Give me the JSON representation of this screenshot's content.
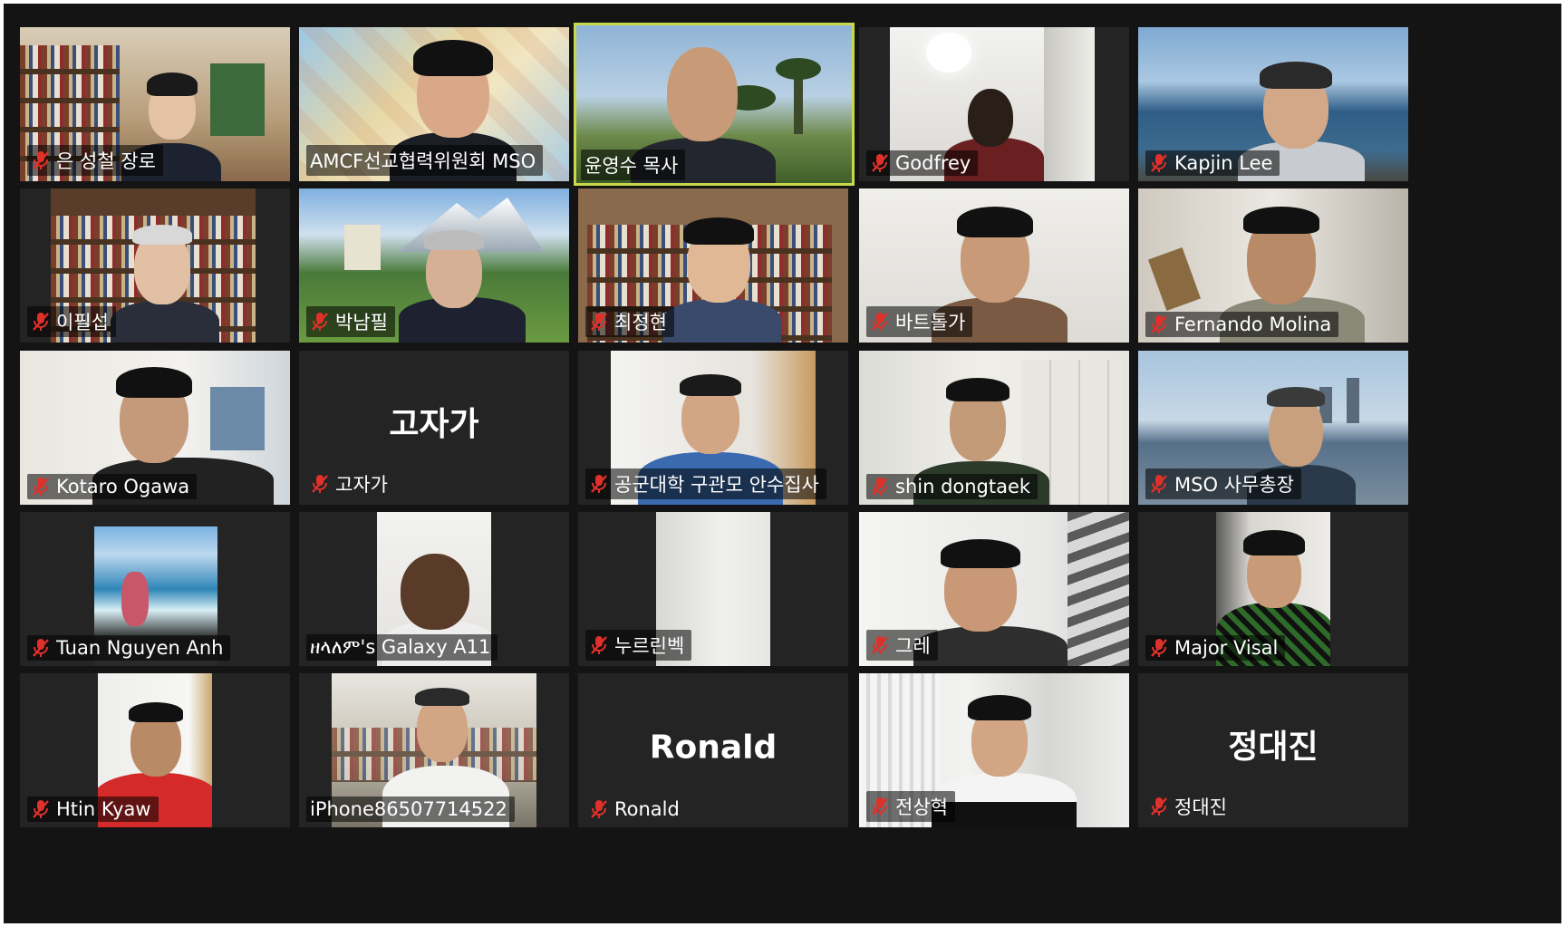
{
  "colors": {
    "background": "#141414",
    "tile": "#242424",
    "active_border": "#c7d84a",
    "muted_mic": "#e0302a",
    "label_text": "#ffffff"
  },
  "participants": [
    {
      "name": "은 성철 장로",
      "muted": true
    },
    {
      "name": "AMCF선교협력위원회 MSO",
      "muted": false
    },
    {
      "name": "윤영수 목사",
      "muted": false,
      "active_speaker": true
    },
    {
      "name": "Godfrey",
      "muted": true
    },
    {
      "name": "Kapjin Lee",
      "muted": true
    },
    {
      "name": "이필섭",
      "muted": true
    },
    {
      "name": "박남필",
      "muted": true
    },
    {
      "name": "최정현",
      "muted": true
    },
    {
      "name": "바트톨가",
      "muted": true
    },
    {
      "name": "Fernando Molina",
      "muted": true
    },
    {
      "name": "Kotaro Ogawa",
      "muted": true
    },
    {
      "name": "고자가",
      "muted": true,
      "video_off": true,
      "display_name": "고자가"
    },
    {
      "name": "공군대학 구관모 안수집사",
      "muted": true
    },
    {
      "name": "shin dongtaek",
      "muted": true
    },
    {
      "name": "MSO 사무총장",
      "muted": true
    },
    {
      "name": "Tuan Nguyen Anh",
      "muted": true
    },
    {
      "name": "ዘላለም's Galaxy A11",
      "muted": false
    },
    {
      "name": "누르린벡",
      "muted": true
    },
    {
      "name": "그레",
      "muted": true
    },
    {
      "name": "Major Visal",
      "muted": true
    },
    {
      "name": "Htin Kyaw",
      "muted": true
    },
    {
      "name": "iPhone86507714522",
      "muted": false
    },
    {
      "name": "Ronald",
      "muted": true,
      "video_off": true,
      "display_name": "Ronald"
    },
    {
      "name": "전상혁",
      "muted": true
    },
    {
      "name": "정대진",
      "muted": true,
      "video_off": true,
      "display_name": "정대진"
    }
  ]
}
